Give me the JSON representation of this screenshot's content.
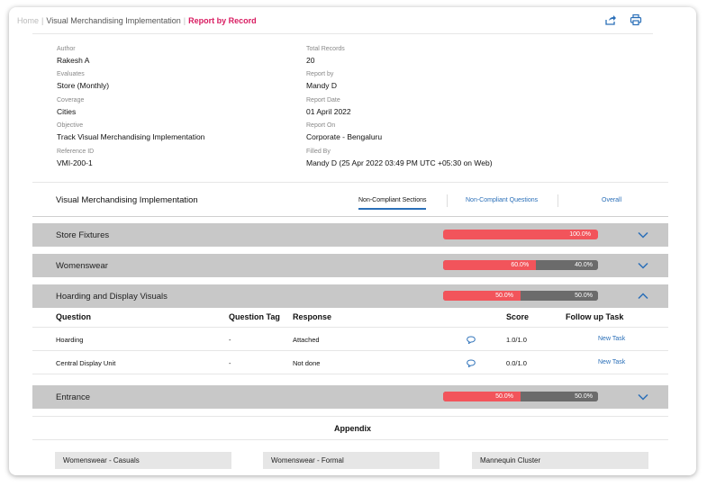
{
  "breadcrumb": {
    "home": "Home",
    "parent": "Visual Merchandising Implementation",
    "current": "Report by Record"
  },
  "toolbar": {
    "icons": [
      "share-pdf-icon",
      "print-icon"
    ]
  },
  "meta": {
    "left": [
      {
        "label": "Author",
        "value": "Rakesh A"
      },
      {
        "label": "Evaluates",
        "value": "Store (Monthly)"
      },
      {
        "label": "Coverage",
        "value": "Cities"
      },
      {
        "label": "Objective",
        "value": "Track Visual Merchandising Implementation"
      },
      {
        "label": "Reference ID",
        "value": "VMI-200-1"
      }
    ],
    "right": [
      {
        "label": "Total Records",
        "value": "20"
      },
      {
        "label": "Report by",
        "value": "Mandy D"
      },
      {
        "label": "Report Date",
        "value": "01 April 2022"
      },
      {
        "label": "Report On",
        "value": "Corporate - Bengaluru"
      },
      {
        "label": "Filled By",
        "value": "Mandy D (25 Apr 2022 03:49 PM UTC +05:30 on Web)"
      }
    ]
  },
  "section": {
    "title": "Visual Merchandising Implementation",
    "tabs": [
      "Non-Compliant Sections",
      "Non-Compliant Questions",
      "Overall"
    ],
    "active_tab": 0
  },
  "sections": [
    {
      "name": "Store Fixtures",
      "red_pct": 100,
      "red_label": "100.0%",
      "grey_label": "",
      "expanded": false
    },
    {
      "name": "Womenswear",
      "red_pct": 60,
      "red_label": "60.0%",
      "grey_label": "40.0%",
      "expanded": false
    },
    {
      "name": "Hoarding and Display Visuals",
      "red_pct": 50,
      "red_label": "50.0%",
      "grey_label": "50.0%",
      "expanded": true
    },
    {
      "name": "Entrance",
      "red_pct": 50,
      "red_label": "50.0%",
      "grey_label": "50.0%",
      "expanded": false
    }
  ],
  "question_table": {
    "headers": [
      "Question",
      "Question Tag",
      "Response",
      "Score",
      "Follow up Task"
    ],
    "rows": [
      {
        "question": "Hoarding",
        "tag": "-",
        "response": "Attached",
        "score": "1.0/1.0",
        "task": "New Task"
      },
      {
        "question": "Central Display Unit",
        "tag": "-",
        "response": "Not done",
        "score": "0.0/1.0",
        "task": "New Task"
      }
    ]
  },
  "appendix": {
    "title": "Appendix",
    "items": [
      "Womenswear - Casuals",
      "Womenswear - Formal",
      "Mannequin Cluster"
    ]
  },
  "colors": {
    "accent": "#d81b60",
    "link": "#2a6fb8",
    "fail": "#f2545b",
    "pass": "#6b6b6b",
    "bar_bg": "#c8c8c8"
  }
}
